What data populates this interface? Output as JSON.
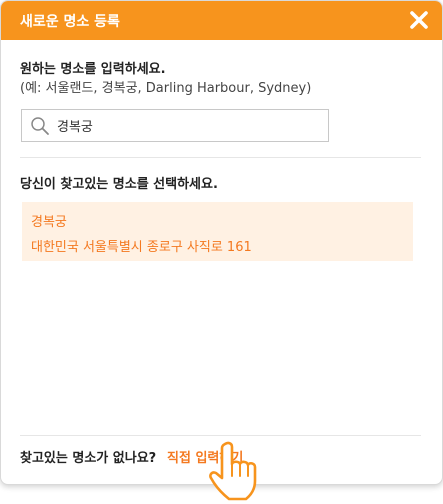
{
  "header": {
    "title": "새로운 명소 등록",
    "close_icon": "close-icon"
  },
  "search_section": {
    "title": "원하는 명소를 입력하세요.",
    "example": "(예: 서울랜드, 경복궁, Darling Harbour, Sydney)",
    "input_value": "경복궁",
    "icon": "search-icon"
  },
  "results_section": {
    "title": "당신이 찾고있는 명소를 선택하세요.",
    "items": [
      {
        "name": "경복궁",
        "address": "대한민국 서울특별시 종로구 사직로 161"
      }
    ]
  },
  "footer": {
    "question": "찾고있는 명소가 없나요?",
    "link": "직접 입력하기",
    "cursor_icon": "hand-pointer-icon"
  },
  "colors": {
    "accent": "#f7941d",
    "accent_text": "#f47920",
    "result_bg": "#fff1e3"
  }
}
